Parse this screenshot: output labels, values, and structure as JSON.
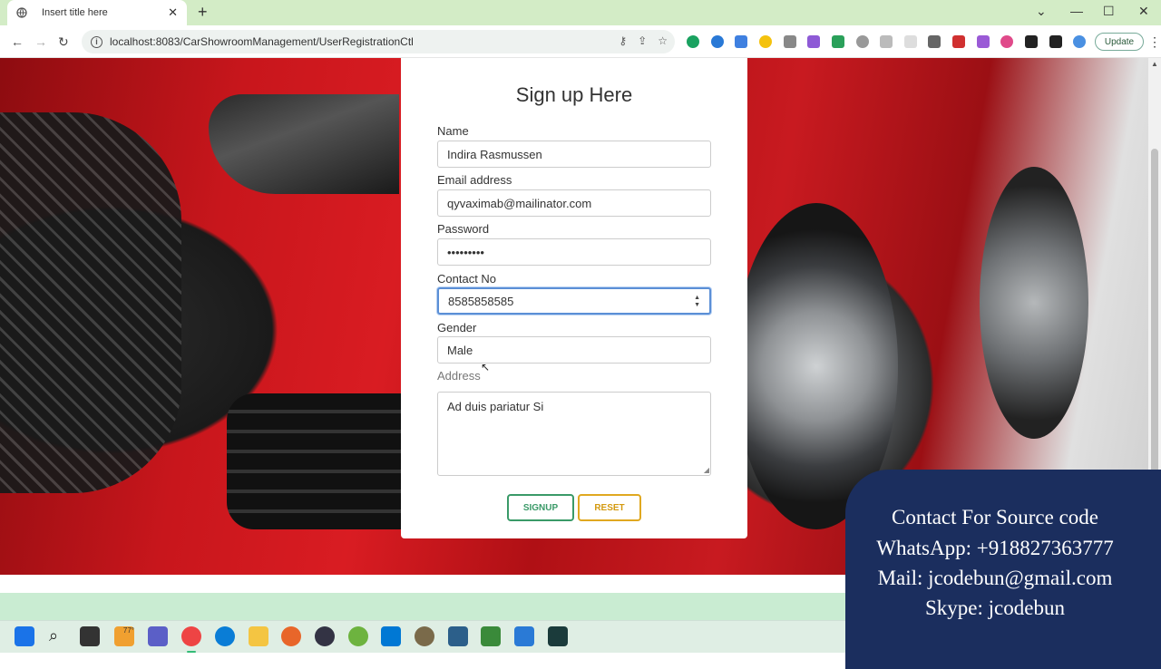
{
  "browser": {
    "tab_title": "Insert title here",
    "tab_close": "✕",
    "new_tab": "+",
    "url": "localhost:8083/CarShowroomManagement/UserRegistrationCtl",
    "update_label": "Update"
  },
  "form": {
    "heading": "Sign up Here",
    "name_label": "Name",
    "name_value": "Indira Rasmussen",
    "email_label": "Email address",
    "email_value": "qyvaximab@mailinator.com",
    "password_label": "Password",
    "password_value": "•••••••••",
    "contact_label": "Contact No",
    "contact_value": "8585858585",
    "gender_label": "Gender",
    "gender_value": "Male",
    "address_label": "Address",
    "address_value": "Ad duis pariatur Si",
    "signup_label": "SIGNUP",
    "reset_label": "RESET"
  },
  "taskbar": {
    "weather": "77°"
  },
  "overlay": {
    "line1": "Contact For Source code",
    "line2": "WhatsApp:   +918827363777",
    "line3": "Mail: jcodebun@gmail.com",
    "line4": "Skype: jcodebun"
  },
  "colors": {
    "signup": "#3a9a68",
    "reset": "#e0a820",
    "overlay_bg": "#1b2e5e",
    "tabbar_bg": "#d3ecc6"
  }
}
